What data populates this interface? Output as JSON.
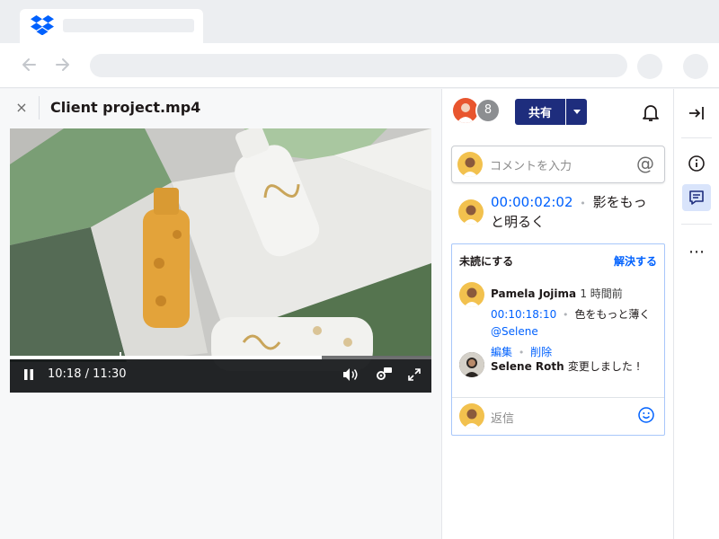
{
  "colors": {
    "accent": "#0061fe",
    "share_button": "#1e2d7d",
    "thread_border": "#a8c7fa"
  },
  "browser": {
    "tab_icon": "dropbox-logo-icon",
    "nav": {
      "back_icon": "arrow-left-icon",
      "forward_icon": "arrow-right-icon"
    }
  },
  "preview": {
    "close_label": "×",
    "file_title": "Client project.mp4",
    "player": {
      "time_display": "10:18 / 11:30",
      "progress_fraction": 0.74,
      "marker_fraction": 0.26,
      "icons": [
        "pause-icon",
        "volume-icon",
        "hd-settings-icon",
        "fullscreen-icon"
      ]
    }
  },
  "panel": {
    "member_count": "8",
    "share_label": "共有",
    "bell_icon": "bell-icon",
    "comment_input": {
      "placeholder": "コメントを入力",
      "mention_label": "@"
    },
    "first_comment": {
      "timestamp": "00:00:02:02",
      "separator": "•",
      "text": "影をもっと明るく"
    },
    "thread": {
      "mark_unread_label": "未読にする",
      "resolve_label": "解決する",
      "author": "Pamela Jojima",
      "time_ago": "1 時間前",
      "timestamp": "00:10:18:10",
      "separator": "•",
      "text": "色をもっと薄く",
      "mention": "@Selene",
      "edit_label": "編集",
      "action_separator": "•",
      "delete_label": "削除",
      "reply_author": "Selene Roth",
      "reply_text": "変更しました !",
      "reply_placeholder": "返信"
    }
  },
  "rail": {
    "icons": [
      "exit-panel-icon",
      "info-icon",
      "comments-icon",
      "more-icon"
    ],
    "more_label": "⋯"
  }
}
